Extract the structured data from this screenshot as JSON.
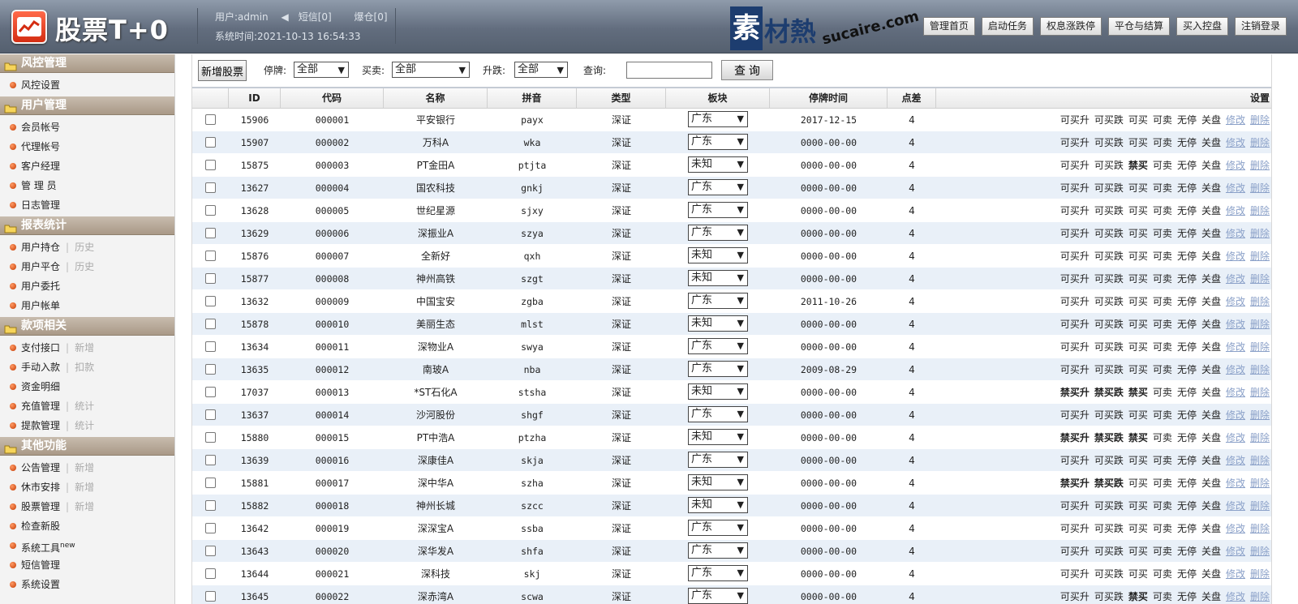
{
  "header": {
    "title": "股票T+0",
    "user": "用户:admin",
    "sms": "短信[0]",
    "burst": "爆仓[0]",
    "time": "系统时间:2021-10-13 16:54:33",
    "watermark_block": "素",
    "watermark_text": "材熱",
    "watermark_url": "sucaire.com",
    "buttons": [
      "管理首页",
      "启动任务",
      "权息涨跌停",
      "平仓与结算",
      "买入控盘",
      "注销登录"
    ]
  },
  "sidebar": [
    {
      "title": "风控管理",
      "items": [
        {
          "label": "风控设置"
        }
      ]
    },
    {
      "title": "用户管理",
      "items": [
        {
          "label": "会员帐号"
        },
        {
          "label": "代理帐号"
        },
        {
          "label": "客户经理"
        },
        {
          "label": "管 理 员"
        },
        {
          "label": "日志管理"
        }
      ]
    },
    {
      "title": "报表统计",
      "items": [
        {
          "label": "用户持仓",
          "sub": "历史"
        },
        {
          "label": "用户平仓",
          "sub": "历史"
        },
        {
          "label": "用户委托"
        },
        {
          "label": "用户帐单"
        }
      ]
    },
    {
      "title": "款项相关",
      "items": [
        {
          "label": "支付接口",
          "sub": "新增"
        },
        {
          "label": "手动入款",
          "sub": "扣款"
        },
        {
          "label": "资金明细"
        },
        {
          "label": "充值管理",
          "sub": "统计"
        },
        {
          "label": "提款管理",
          "sub": "统计"
        }
      ]
    },
    {
      "title": "其他功能",
      "items": [
        {
          "label": "公告管理",
          "sub": "新增"
        },
        {
          "label": "休市安排",
          "sub": "新增"
        },
        {
          "label": "股票管理",
          "sub": "新增"
        },
        {
          "label": "检查新股"
        },
        {
          "label": "系统工具",
          "sup": "new"
        },
        {
          "label": "短信管理"
        },
        {
          "label": "系统设置"
        }
      ]
    }
  ],
  "filters": {
    "add_button": "新增股票",
    "suspend_label": "停牌:",
    "suspend_value": "全部",
    "trade_label": "买卖:",
    "trade_value": "全部",
    "updown_label": "升跌:",
    "updown_value": "全部",
    "query_label": "查询:",
    "query_value": "",
    "search_button": "查 询"
  },
  "table": {
    "columns": [
      "",
      "ID",
      "代码",
      "名称",
      "拼音",
      "类型",
      "板块",
      "停牌时间",
      "点差",
      "设置"
    ],
    "rows": [
      {
        "id": "15906",
        "code": "000001",
        "name": "平安银行",
        "py": "payx",
        "type": "深证",
        "plate": "广东",
        "date": "2017-12-15",
        "diff": "4",
        "acts": [
          "可买升",
          "可买跌",
          "可买",
          "可卖",
          "无停",
          "关盘"
        ]
      },
      {
        "id": "15907",
        "code": "000002",
        "name": "万科A",
        "py": "wka",
        "type": "深证",
        "plate": "广东",
        "date": "0000-00-00",
        "diff": "4",
        "acts": [
          "可买升",
          "可买跌",
          "可买",
          "可卖",
          "无停",
          "关盘"
        ]
      },
      {
        "id": "15875",
        "code": "000003",
        "name": "PT金田A",
        "py": "ptjta",
        "type": "深证",
        "plate": "未知",
        "date": "0000-00-00",
        "diff": "4",
        "acts": [
          "可买升",
          "可买跌",
          "禁买",
          "可卖",
          "无停",
          "关盘"
        ]
      },
      {
        "id": "13627",
        "code": "000004",
        "name": "国农科技",
        "py": "gnkj",
        "type": "深证",
        "plate": "广东",
        "date": "0000-00-00",
        "diff": "4",
        "acts": [
          "可买升",
          "可买跌",
          "可买",
          "可卖",
          "无停",
          "关盘"
        ]
      },
      {
        "id": "13628",
        "code": "000005",
        "name": "世纪星源",
        "py": "sjxy",
        "type": "深证",
        "plate": "广东",
        "date": "0000-00-00",
        "diff": "4",
        "acts": [
          "可买升",
          "可买跌",
          "可买",
          "可卖",
          "无停",
          "关盘"
        ]
      },
      {
        "id": "13629",
        "code": "000006",
        "name": "深振业A",
        "py": "szya",
        "type": "深证",
        "plate": "广东",
        "date": "0000-00-00",
        "diff": "4",
        "acts": [
          "可买升",
          "可买跌",
          "可买",
          "可卖",
          "无停",
          "关盘"
        ]
      },
      {
        "id": "15876",
        "code": "000007",
        "name": "全新好",
        "py": "qxh",
        "type": "深证",
        "plate": "未知",
        "date": "0000-00-00",
        "diff": "4",
        "acts": [
          "可买升",
          "可买跌",
          "可买",
          "可卖",
          "无停",
          "关盘"
        ]
      },
      {
        "id": "15877",
        "code": "000008",
        "name": "神州高铁",
        "py": "szgt",
        "type": "深证",
        "plate": "未知",
        "date": "0000-00-00",
        "diff": "4",
        "acts": [
          "可买升",
          "可买跌",
          "可买",
          "可卖",
          "无停",
          "关盘"
        ]
      },
      {
        "id": "13632",
        "code": "000009",
        "name": "中国宝安",
        "py": "zgba",
        "type": "深证",
        "plate": "广东",
        "date": "2011-10-26",
        "diff": "4",
        "acts": [
          "可买升",
          "可买跌",
          "可买",
          "可卖",
          "无停",
          "关盘"
        ]
      },
      {
        "id": "15878",
        "code": "000010",
        "name": "美丽生态",
        "py": "mlst",
        "type": "深证",
        "plate": "未知",
        "date": "0000-00-00",
        "diff": "4",
        "acts": [
          "可买升",
          "可买跌",
          "可买",
          "可卖",
          "无停",
          "关盘"
        ]
      },
      {
        "id": "13634",
        "code": "000011",
        "name": "深物业A",
        "py": "swya",
        "type": "深证",
        "plate": "广东",
        "date": "0000-00-00",
        "diff": "4",
        "acts": [
          "可买升",
          "可买跌",
          "可买",
          "可卖",
          "无停",
          "关盘"
        ]
      },
      {
        "id": "13635",
        "code": "000012",
        "name": "南玻A",
        "py": "nba",
        "type": "深证",
        "plate": "广东",
        "date": "2009-08-29",
        "diff": "4",
        "acts": [
          "可买升",
          "可买跌",
          "可买",
          "可卖",
          "无停",
          "关盘"
        ]
      },
      {
        "id": "17037",
        "code": "000013",
        "name": "*ST石化A",
        "py": "stsha",
        "type": "深证",
        "plate": "未知",
        "date": "0000-00-00",
        "diff": "4",
        "acts": [
          "禁买升",
          "禁买跌",
          "禁买",
          "可卖",
          "无停",
          "关盘"
        ]
      },
      {
        "id": "13637",
        "code": "000014",
        "name": "沙河股份",
        "py": "shgf",
        "type": "深证",
        "plate": "广东",
        "date": "0000-00-00",
        "diff": "4",
        "acts": [
          "可买升",
          "可买跌",
          "可买",
          "可卖",
          "无停",
          "关盘"
        ]
      },
      {
        "id": "15880",
        "code": "000015",
        "name": "PT中浩A",
        "py": "ptzha",
        "type": "深证",
        "plate": "未知",
        "date": "0000-00-00",
        "diff": "4",
        "acts": [
          "禁买升",
          "禁买跌",
          "禁买",
          "可卖",
          "无停",
          "关盘"
        ]
      },
      {
        "id": "13639",
        "code": "000016",
        "name": "深康佳A",
        "py": "skja",
        "type": "深证",
        "plate": "广东",
        "date": "0000-00-00",
        "diff": "4",
        "acts": [
          "可买升",
          "可买跌",
          "可买",
          "可卖",
          "无停",
          "关盘"
        ]
      },
      {
        "id": "15881",
        "code": "000017",
        "name": "深中华A",
        "py": "szha",
        "type": "深证",
        "plate": "未知",
        "date": "0000-00-00",
        "diff": "4",
        "acts": [
          "禁买升",
          "禁买跌",
          "可买",
          "可卖",
          "无停",
          "关盘"
        ]
      },
      {
        "id": "15882",
        "code": "000018",
        "name": "神州长城",
        "py": "szcc",
        "type": "深证",
        "plate": "未知",
        "date": "0000-00-00",
        "diff": "4",
        "acts": [
          "可买升",
          "可买跌",
          "可买",
          "可卖",
          "无停",
          "关盘"
        ]
      },
      {
        "id": "13642",
        "code": "000019",
        "name": "深深宝A",
        "py": "ssba",
        "type": "深证",
        "plate": "广东",
        "date": "0000-00-00",
        "diff": "4",
        "acts": [
          "可买升",
          "可买跌",
          "可买",
          "可卖",
          "无停",
          "关盘"
        ]
      },
      {
        "id": "13643",
        "code": "000020",
        "name": "深华发A",
        "py": "shfa",
        "type": "深证",
        "plate": "广东",
        "date": "0000-00-00",
        "diff": "4",
        "acts": [
          "可买升",
          "可买跌",
          "可买",
          "可卖",
          "无停",
          "关盘"
        ]
      },
      {
        "id": "13644",
        "code": "000021",
        "name": "深科技",
        "py": "skj",
        "type": "深证",
        "plate": "广东",
        "date": "0000-00-00",
        "diff": "4",
        "acts": [
          "可买升",
          "可买跌",
          "可买",
          "可卖",
          "无停",
          "关盘"
        ]
      },
      {
        "id": "13645",
        "code": "000022",
        "name": "深赤湾A",
        "py": "scwa",
        "type": "深证",
        "plate": "广东",
        "date": "0000-00-00",
        "diff": "4",
        "acts": [
          "可买升",
          "可买跌",
          "禁买",
          "可卖",
          "无停",
          "关盘"
        ]
      }
    ],
    "edit_label": "修改",
    "delete_label": "删除"
  }
}
